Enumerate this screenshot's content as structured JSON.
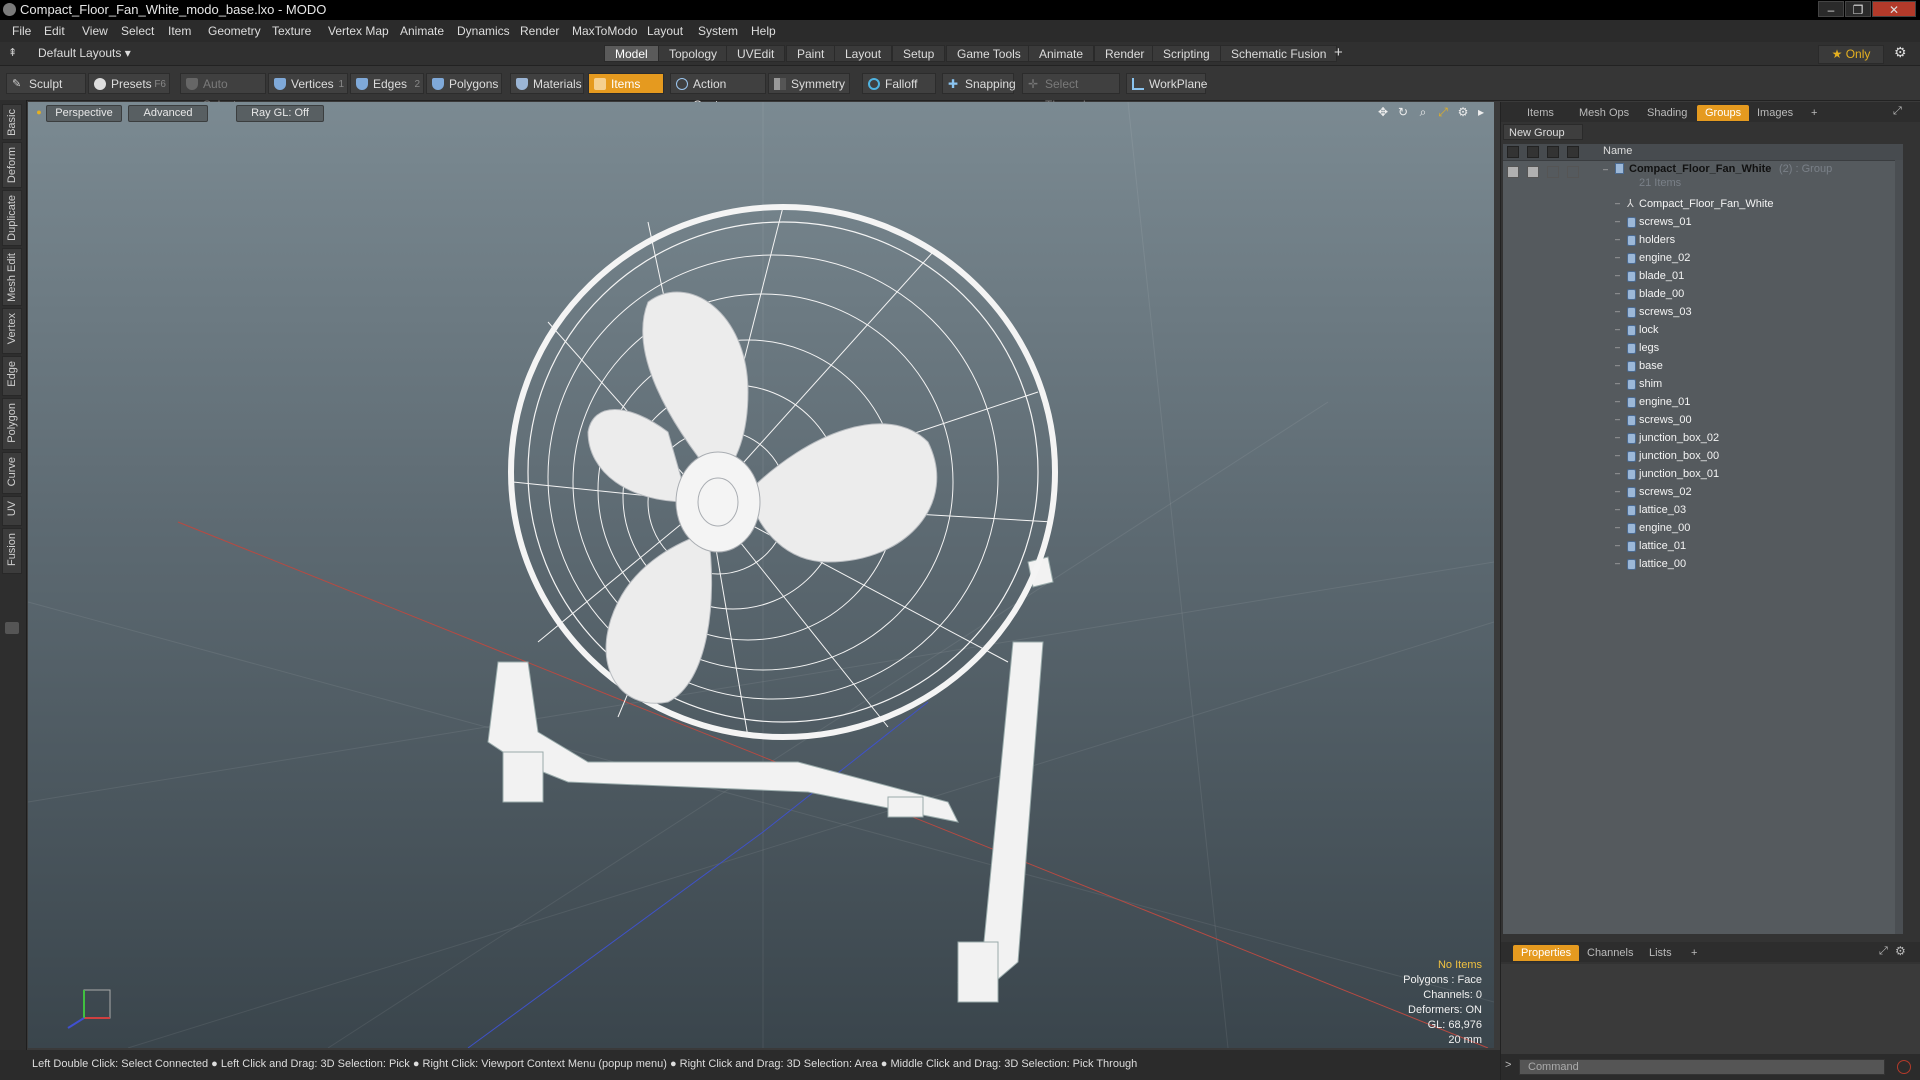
{
  "window": {
    "title": "Compact_Floor_Fan_White_modo_base.lxo - MODO",
    "minimize_glyph": "‒",
    "maximize_glyph": "❐",
    "close_glyph": "✕"
  },
  "menu": [
    "File",
    "Edit",
    "View",
    "Select",
    "Item",
    "Geometry",
    "Texture",
    "Vertex Map",
    "Animate",
    "Dynamics",
    "Render",
    "MaxToModo",
    "Layout",
    "System",
    "Help"
  ],
  "layout_bar": {
    "layout_selector": "Default Layouts ▾",
    "tabs": [
      "Model",
      "Topology",
      "UVEdit",
      "Paint",
      "Layout",
      "Setup",
      "Game Tools",
      "Animate",
      "Render",
      "Scripting",
      "Schematic Fusion"
    ],
    "active_tab": "Model",
    "add": "+",
    "only_label": "★ Only",
    "settings": "⚙"
  },
  "toolbar": {
    "sculpt": "Sculpt",
    "presets": "Presets",
    "presets_key": "F6",
    "auto_select": "Auto Select",
    "vertices": "Vertices",
    "vertices_key": "1",
    "edges": "Edges",
    "edges_key": "2",
    "polygons": "Polygons",
    "materials": "Materials",
    "items": "Items",
    "action_center": "Action Center",
    "symmetry": "Symmetry",
    "falloff": "Falloff",
    "snapping": "Snapping",
    "select_through": "Select Through",
    "workplane": "WorkPlane"
  },
  "left_tabs": [
    "Basic",
    "Deform",
    "Duplicate",
    "Mesh Edit",
    "Vertex",
    "Edge",
    "Polygon",
    "Curve",
    "UV",
    "Fusion"
  ],
  "viewport": {
    "perspective": "Perspective",
    "advanced": "Advanced",
    "ray_gl": "Ray GL: Off",
    "info": {
      "no_items": "No Items",
      "polygons": "Polygons : Face",
      "channels": "Channels: 0",
      "deformers": "Deformers: ON",
      "gl": "GL: 68,976",
      "size": "20 mm"
    }
  },
  "status_bar": "Left Double Click: Select Connected ● Left Click and Drag: 3D Selection: Pick ● Right Click: Viewport Context Menu (popup menu) ● Right Click and Drag: 3D Selection: Area ● Middle Click and Drag: 3D Selection: Pick Through",
  "right_panel": {
    "tabs": [
      "Items",
      "Mesh Ops",
      "Shading",
      "Groups",
      "Images"
    ],
    "active_tab": "Groups",
    "add": "+",
    "new_group": "New Group",
    "column_name": "Name",
    "group": {
      "name": "Compact_Floor_Fan_White",
      "suffix": "(2) : Group",
      "count": "21 Items"
    },
    "items": [
      "Compact_Floor_Fan_White",
      "screws_01",
      "holders",
      "engine_02",
      "blade_01",
      "blade_00",
      "screws_03",
      "lock",
      "legs",
      "base",
      "shim",
      "engine_01",
      "screws_00",
      "junction_box_02",
      "junction_box_00",
      "junction_box_01",
      "screws_02",
      "lattice_03",
      "engine_00",
      "lattice_01",
      "lattice_00"
    ],
    "bottom_tabs": [
      "Properties",
      "Channels",
      "Lists"
    ],
    "bottom_active": "Properties",
    "command_placeholder": "Command"
  },
  "colors": {
    "accent": "#e59a1f",
    "viewport_top": "#7b8a92",
    "viewport_bottom": "#3a454c"
  }
}
